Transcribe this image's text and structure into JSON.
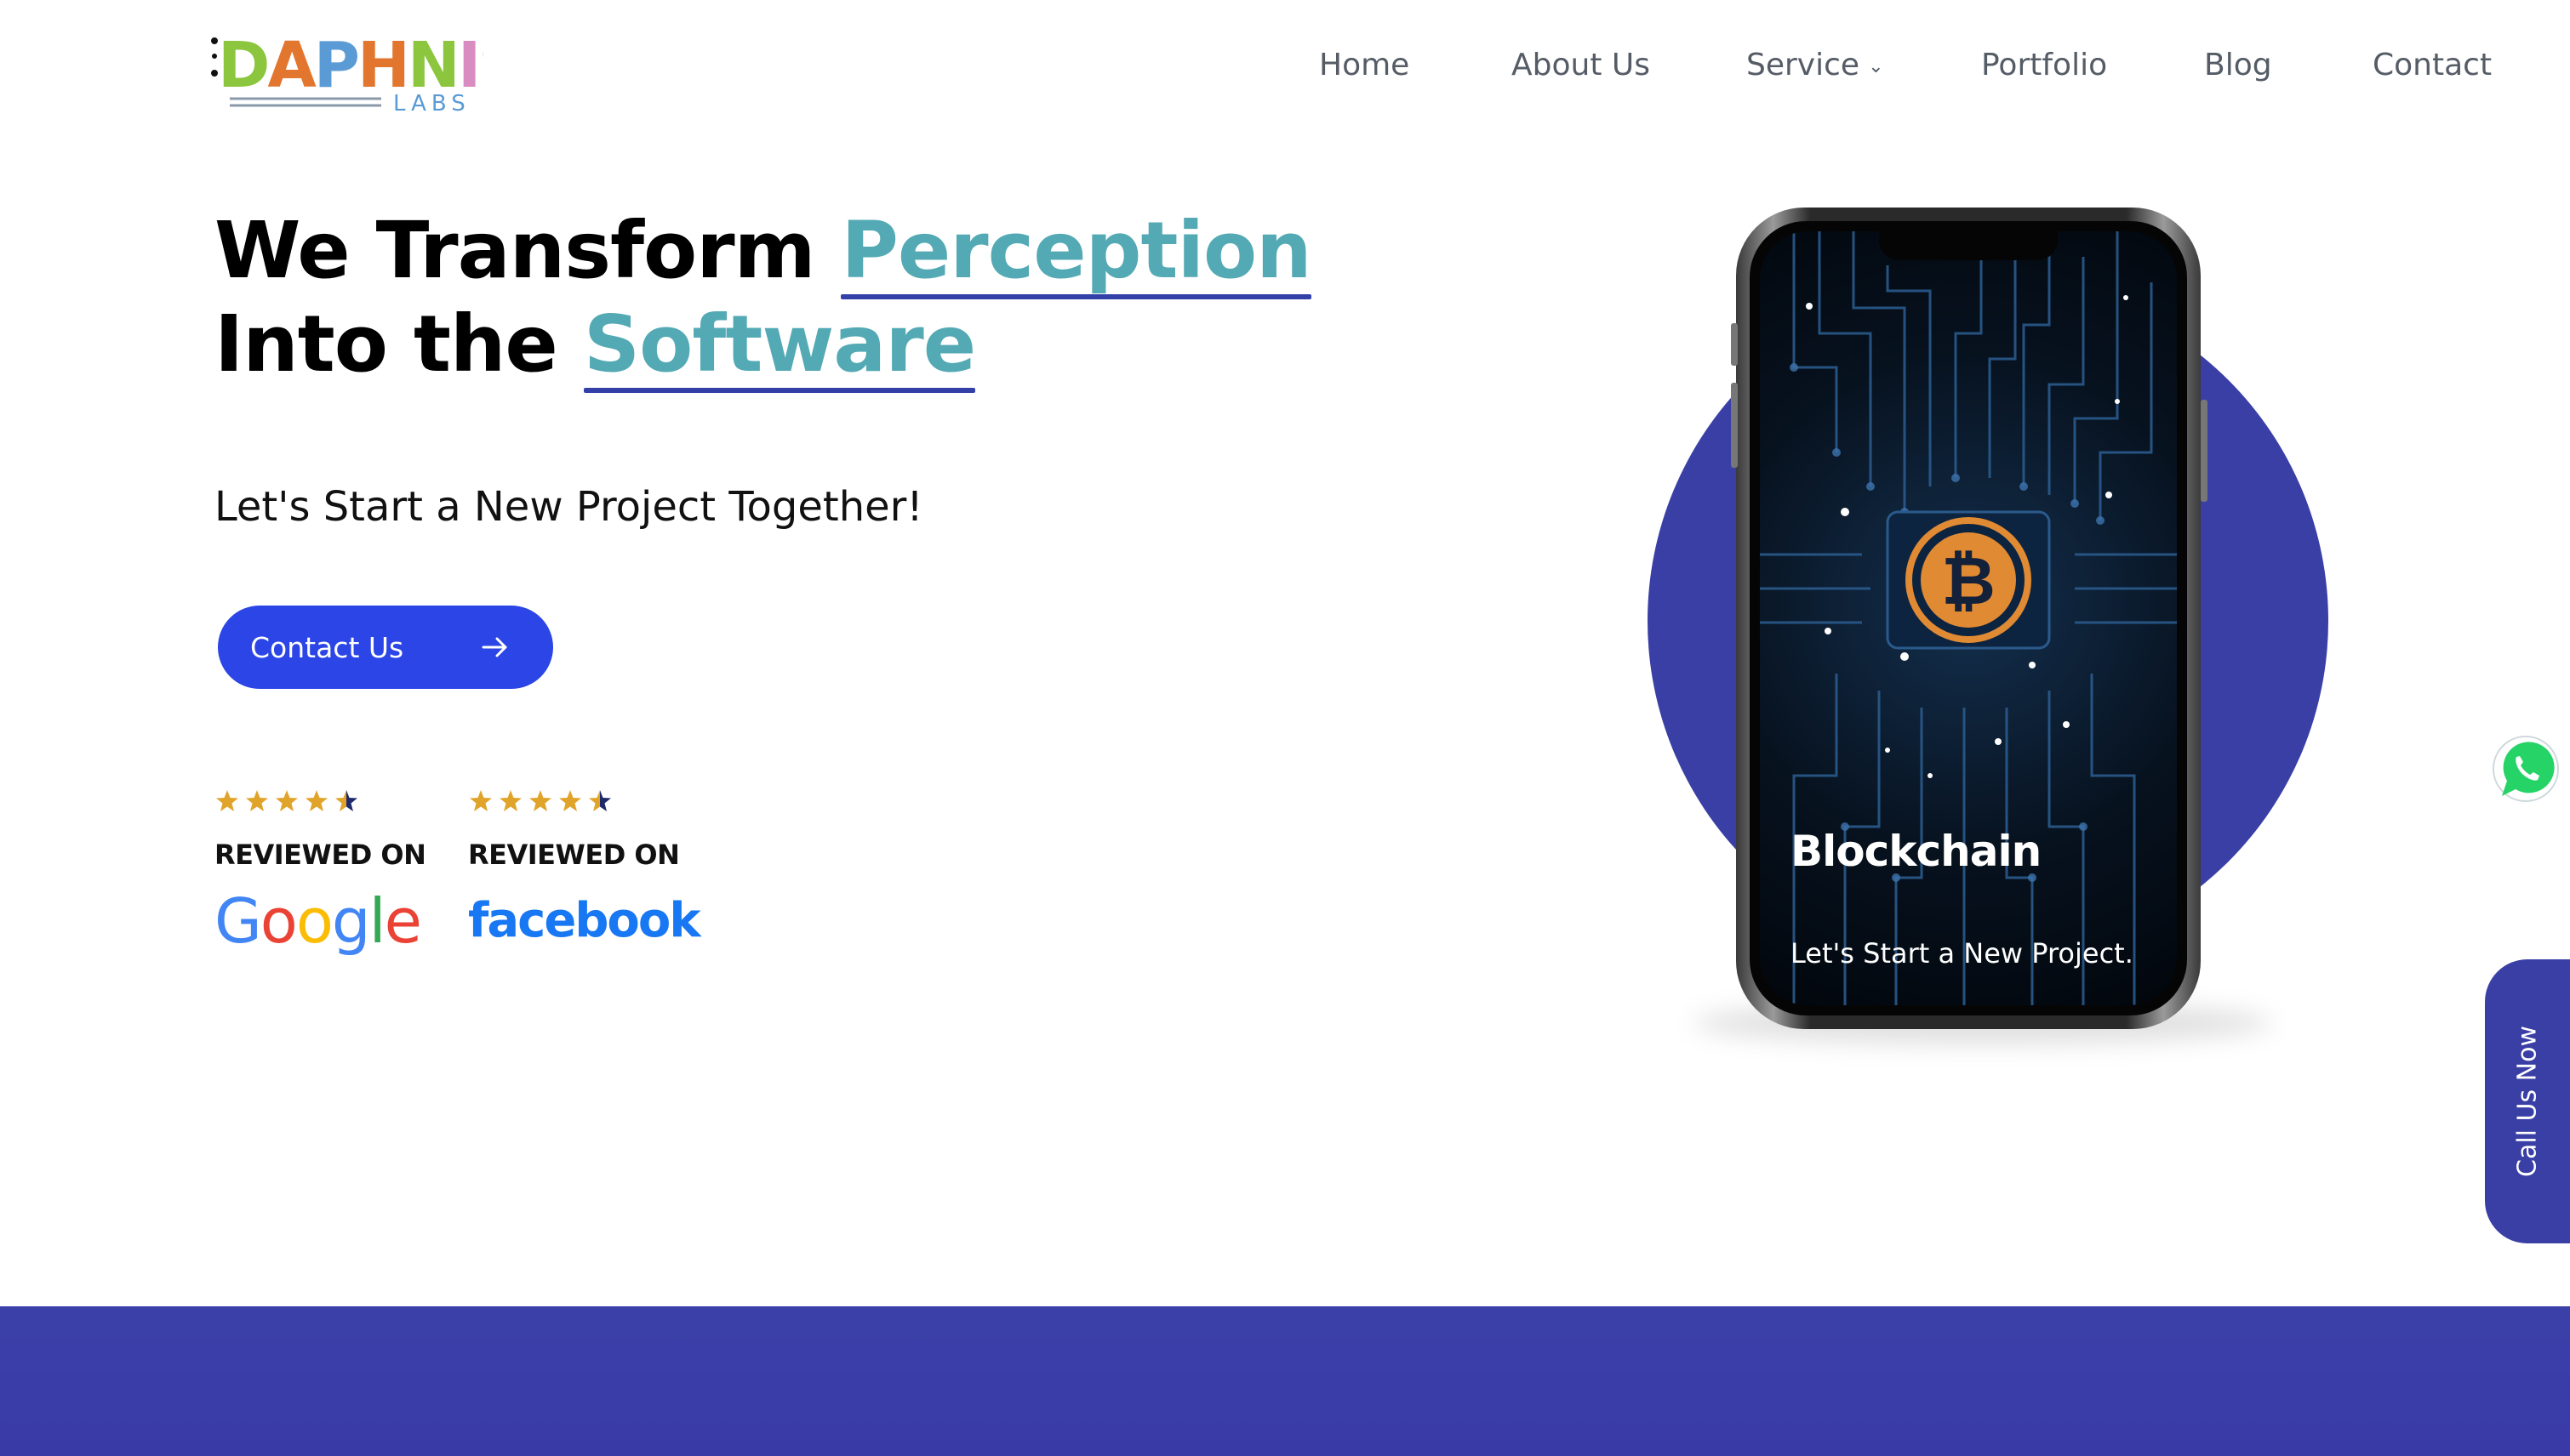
{
  "header": {
    "logo": {
      "main": "DAPHNIS",
      "sub": "LABS"
    },
    "nav": [
      {
        "label": "Home"
      },
      {
        "label": "About Us"
      },
      {
        "label": "Service",
        "has_dropdown": true
      },
      {
        "label": "Portfolio"
      },
      {
        "label": "Blog"
      },
      {
        "label": "Contact"
      }
    ]
  },
  "hero": {
    "title_line1_prefix": "We Transform ",
    "title_line1_accent": "Perception",
    "title_line2_prefix": "Into the ",
    "title_line2_accent": "Software",
    "subtitle": "Let's Start a New Project Together!",
    "cta_label": "Contact Us",
    "cta_icon": "arrow-right-icon"
  },
  "reviews": [
    {
      "rating": 4.5,
      "max": 5,
      "label": "REVIEWED ON",
      "platform": "Google"
    },
    {
      "rating": 4.5,
      "max": 5,
      "label": "REVIEWED ON",
      "platform": "facebook"
    }
  ],
  "phone": {
    "screen_title": "Blockchain",
    "screen_subtitle": "Let's Start a New Project.",
    "screen_icon": "bitcoin-icon"
  },
  "floating": {
    "whatsapp_icon": "whatsapp-icon",
    "call_label": "Call Us Now"
  },
  "colors": {
    "accent_teal": "#54aab4",
    "underline": "#3340a8",
    "cta_blue": "#2b45e6",
    "brand_indigo": "#3a3fa6",
    "star_gold": "#e1a42a",
    "facebook_blue": "#1877f2",
    "whatsapp_green": "#25d366"
  }
}
